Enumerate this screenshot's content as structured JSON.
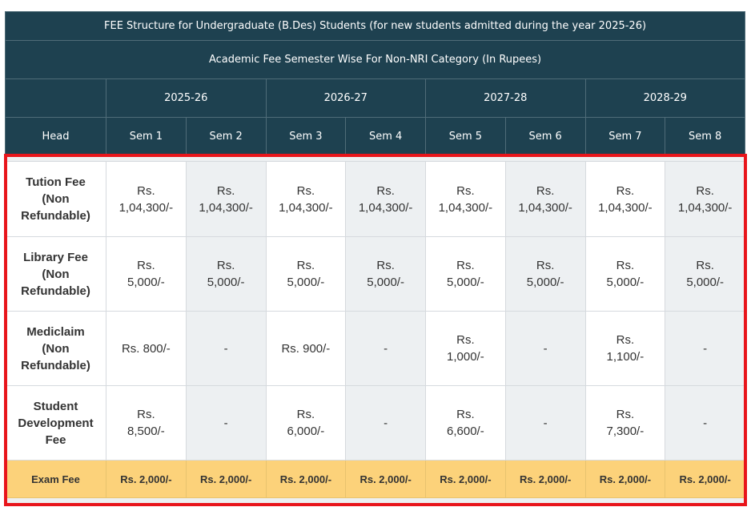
{
  "table": {
    "title": "FEE Structure for Undergraduate (B.Des) Students (for new students admitted during the year 2025-26)",
    "subtitle": "Academic Fee Semester Wise For Non-NRI Category (In Rupees)",
    "years": [
      "2025-26",
      "2026-27",
      "2027-28",
      "2028-29"
    ],
    "head_label": "Head",
    "semesters": [
      "Sem 1",
      "Sem 2",
      "Sem 3",
      "Sem 4",
      "Sem 5",
      "Sem 6",
      "Sem 7",
      "Sem 8"
    ],
    "rows": [
      {
        "head_lines": [
          "Tution Fee",
          "(Non",
          "Refundable)"
        ],
        "cells": [
          [
            "Rs.",
            "1,04,300/-"
          ],
          [
            "Rs.",
            "1,04,300/-"
          ],
          [
            "Rs.",
            "1,04,300/-"
          ],
          [
            "Rs.",
            "1,04,300/-"
          ],
          [
            "Rs.",
            "1,04,300/-"
          ],
          [
            "Rs.",
            "1,04,300/-"
          ],
          [
            "Rs.",
            "1,04,300/-"
          ],
          [
            "Rs.",
            "1,04,300/-"
          ]
        ]
      },
      {
        "head_lines": [
          "Library Fee",
          "(Non",
          "Refundable)"
        ],
        "cells": [
          [
            "Rs.",
            "5,000/-"
          ],
          [
            "Rs.",
            "5,000/-"
          ],
          [
            "Rs.",
            "5,000/-"
          ],
          [
            "Rs.",
            "5,000/-"
          ],
          [
            "Rs.",
            "5,000/-"
          ],
          [
            "Rs.",
            "5,000/-"
          ],
          [
            "Rs.",
            "5,000/-"
          ],
          [
            "Rs.",
            "5,000/-"
          ]
        ]
      },
      {
        "head_lines": [
          "Mediclaim",
          "(Non",
          "Refundable)"
        ],
        "cells": [
          [
            "Rs. 800/-"
          ],
          [
            "-"
          ],
          [
            "Rs. 900/-"
          ],
          [
            "-"
          ],
          [
            "Rs.",
            "1,000/-"
          ],
          [
            "-"
          ],
          [
            "Rs.",
            "1,100/-"
          ],
          [
            "-"
          ]
        ]
      },
      {
        "head_lines": [
          "Student",
          "Development",
          "Fee"
        ],
        "cells": [
          [
            "Rs.",
            "8,500/-"
          ],
          [
            "-"
          ],
          [
            "Rs.",
            "6,000/-"
          ],
          [
            "-"
          ],
          [
            "Rs.",
            "6,600/-"
          ],
          [
            "-"
          ],
          [
            "Rs.",
            "7,300/-"
          ],
          [
            "-"
          ]
        ]
      }
    ],
    "exam_row": {
      "head": "Exam Fee",
      "cells": [
        "Rs. 2,000/-",
        "Rs. 2,000/-",
        "Rs. 2,000/-",
        "Rs. 2,000/-",
        "Rs. 2,000/-",
        "Rs. 2,000/-",
        "Rs. 2,000/-",
        "Rs. 2,000/-"
      ]
    }
  },
  "colors": {
    "header_bg": "#1e4150",
    "exam_bg": "#fcd27a",
    "highlight_border": "#e8151b",
    "alt_cell_bg": "#edf0f2"
  }
}
